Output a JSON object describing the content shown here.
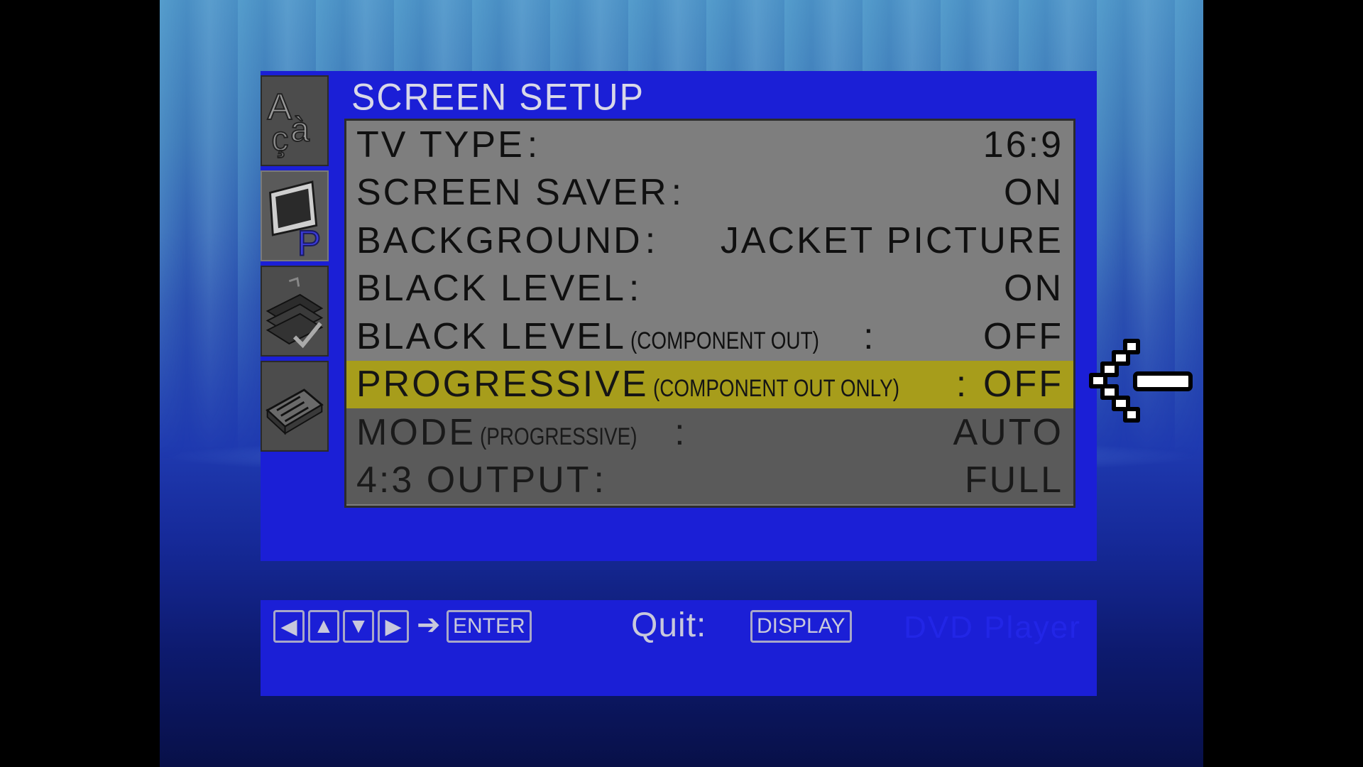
{
  "panel": {
    "title": "SCREEN SETUP"
  },
  "side_icons": [
    {
      "icon": "language-icon"
    },
    {
      "icon": "screen-setup-icon",
      "active": true
    },
    {
      "icon": "custom-setup-icon"
    },
    {
      "icon": "audio-setup-icon"
    }
  ],
  "settings": [
    {
      "label": "TV TYPE",
      "sub": "",
      "value": "16:9",
      "state": "normal"
    },
    {
      "label": "SCREEN SAVER",
      "sub": "",
      "value": "ON",
      "state": "normal"
    },
    {
      "label": "BACKGROUND",
      "sub": "",
      "value": "JACKET PICTURE",
      "state": "normal"
    },
    {
      "label": "BLACK LEVEL",
      "sub": "",
      "value": "ON",
      "state": "normal"
    },
    {
      "label": "BLACK LEVEL",
      "sub": "(COMPONENT OUT)",
      "value": "OFF",
      "state": "normal"
    },
    {
      "label": "PROGRESSIVE",
      "sub": "(COMPONENT OUT ONLY)",
      "value": "OFF",
      "state": "selected"
    },
    {
      "label": "MODE",
      "sub": "(PROGRESSIVE)",
      "value": "AUTO",
      "state": "dim"
    },
    {
      "label": "4:3 OUTPUT",
      "sub": "",
      "value": "FULL",
      "state": "dim"
    }
  ],
  "colon": ":",
  "nav": {
    "keys": [
      "◀",
      "▲",
      "▼",
      "▶"
    ],
    "arrow": "➔",
    "enter_label": "ENTER",
    "quit_label": "Quit:",
    "display_label": "DISPLAY",
    "brand": "DVD Player"
  },
  "colors": {
    "panel_blue": "#1b1fd6",
    "list_gray": "#7e7e7e",
    "highlight": "#a79d1b"
  }
}
